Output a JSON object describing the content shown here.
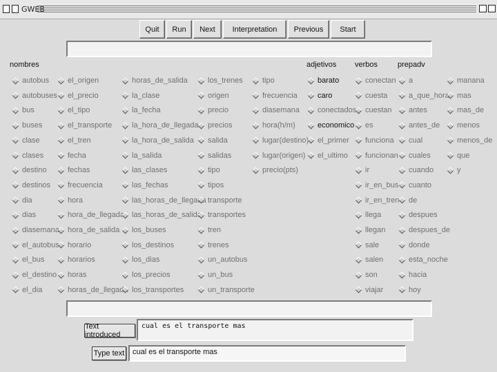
{
  "window": {
    "title": "GWEB"
  },
  "toolbar": {
    "buttons": [
      "Quit",
      "Run",
      "Next",
      "Interpretation",
      "Previous",
      "Start"
    ]
  },
  "headers": {
    "nombres": "nombres",
    "adjetivos": "adjetivos",
    "verbos": "verbos",
    "prepadv": "prepadv"
  },
  "columns": {
    "nombres_1": [
      "autobus",
      "autobuses",
      "bus",
      "buses",
      "clase",
      "clases",
      "destino",
      "destinos",
      "dia",
      "dias",
      "diasemana",
      "el_autobus",
      "el_bus",
      "el_destino",
      "el_dia"
    ],
    "nombres_2": [
      "el_origen",
      "el_precio",
      "el_tipo",
      "el_transporte",
      "el_tren",
      "fecha",
      "fechas",
      "frecuencia",
      "hora",
      "hora_de_llegada",
      "hora_de_salida",
      "horario",
      "horarios",
      "horas",
      "horas_de_llegada"
    ],
    "nombres_3": [
      "horas_de_salida",
      "la_clase",
      "la_fecha",
      "la_hora_de_llegada",
      "la_hora_de_salida",
      "la_salida",
      "las_clases",
      "las_fechas",
      "las_horas_de_llegada",
      "las_horas_de_salida",
      "los_buses",
      "los_destinos",
      "los_dias",
      "los_precios",
      "los_transportes"
    ],
    "nombres_4": [
      "los_trenes",
      "origen",
      "precio",
      "precios",
      "salida",
      "salidas",
      "tipo",
      "tipos",
      "transporte",
      "transportes",
      "tren",
      "trenes",
      "un_autobus",
      "un_bus",
      "un_transporte"
    ],
    "nombres_5": [
      "tipo",
      "frecuencia",
      "diasemana",
      "hora(h/m)",
      "lugar(destino)",
      "lugar(origen)",
      "precio(pts)"
    ],
    "adjetivos": [
      "barato",
      "caro",
      "conectados",
      "economico",
      "el_primer",
      "el_ultimo"
    ],
    "verbos": [
      "conectan",
      "cuesta",
      "cuestan",
      "es",
      "funciona",
      "funcionan",
      "ir",
      "ir_en_bus",
      "ir_en_tren",
      "llega",
      "llegan",
      "sale",
      "salen",
      "son",
      "viajar"
    ],
    "prepadv_1": [
      "a",
      "a_que_hora",
      "antes",
      "antes_de",
      "cual",
      "cuales",
      "cuando",
      "cuanto",
      "de",
      "despues",
      "despues_de",
      "donde",
      "esta_noche",
      "hacia",
      "hoy"
    ],
    "prepadv_2": [
      "manana",
      "mas",
      "mas_de",
      "menos",
      "menos_de",
      "que",
      "y"
    ]
  },
  "selected": {
    "adjetivos": [
      "barato",
      "caro",
      "economico"
    ]
  },
  "bottom": {
    "introduced_label": "Text introduced",
    "introduced_text": "cual es el transporte mas",
    "type_label": "Type text",
    "type_value": "cual es el transporte mas"
  }
}
